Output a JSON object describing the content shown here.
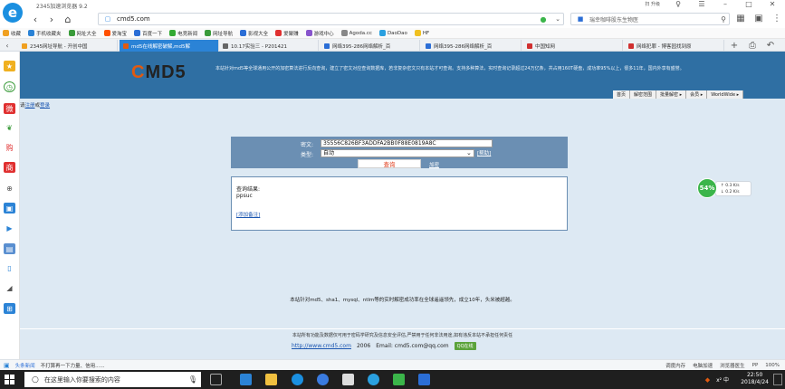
{
  "titlebar": {
    "app_title": "2345加速浏览器 9.2",
    "tray_text": "扫 升级"
  },
  "addressbar": {
    "url": "cmd5.com",
    "search_text": "瑞幸咖啡股东生物医",
    "shield_label": "S"
  },
  "bookmarks": [
    {
      "label": "收藏",
      "color": "#f0a020"
    },
    {
      "label": "手机收藏夹",
      "color": "#2b83d6"
    },
    {
      "label": "网址大全",
      "color": "#3a9b3a"
    },
    {
      "label": "爱淘宝",
      "color": "#ff5000"
    },
    {
      "label": "百度一下",
      "color": "#2b6ed6"
    },
    {
      "label": "电竞新闻",
      "color": "#33aa33"
    },
    {
      "label": "网址导航",
      "color": "#3a9b3a"
    },
    {
      "label": "影视大全",
      "color": "#2b6ed6"
    },
    {
      "label": "爱聚赚",
      "color": "#e03030"
    },
    {
      "label": "游戏中心",
      "color": "#8855cc"
    },
    {
      "label": "Agoda.cc",
      "color": "#888888"
    },
    {
      "label": "DaoDao",
      "color": "#2aa0e0"
    },
    {
      "label": "HF",
      "color": "#f0c020"
    }
  ],
  "tabs": [
    {
      "label": "2345网址导航 - 开创中国",
      "active": false,
      "color": "#f0a020"
    },
    {
      "label": "md5在线解密破解,md5解",
      "active": true,
      "color": "#e05a10"
    },
    {
      "label": "10.17实验三 - P201421",
      "active": false,
      "color": "#666666"
    },
    {
      "label": "网络395-286网络解析_百",
      "active": false,
      "color": "#2b6ed6"
    },
    {
      "label": "网络395-286网络解析_百",
      "active": false,
      "color": "#2b6ed6"
    },
    {
      "label": "中国知网",
      "active": false,
      "color": "#d03030"
    },
    {
      "label": "网络犯罪 - 博客园找到原",
      "active": false,
      "color": "#d03030"
    }
  ],
  "page": {
    "logo_c": "C",
    "logo_rest": "MD5",
    "header_desc": "本站针对md5等全球通用公开的加密算法进行反向查询，建立了密文对应查询数据库，若非复杂密文只有本站才可查询。支持多种算法，实时查询记录超过24万亿条，共占用160T硬盘，成功率95%以上，很多11年，国内外享有盛誉。",
    "top_nav": [
      "首页",
      "解密范围",
      "批量解密 ▸",
      "会员 ▸",
      "WorldWide ▸"
    ],
    "login_prefix": "请",
    "register_link": "注册",
    "or_text": "或",
    "login_link": "登录",
    "ciphertext_label": "密文:",
    "ciphertext_value": "35556C826BF3ADDFA2BB0F88E0819A8C",
    "type_label": "类型:",
    "type_value": "自动",
    "type_help": "[帮助]",
    "query_button": "查询",
    "encrypt_link": "加密",
    "result_title": "查询结果:",
    "result_value": "ppsuc",
    "add_note": "[添加备注]",
    "slogan": "本站针对md5、sha1、mysql、ntlm等的实时解密成功率在全球遥遥领先，成立10年，头米被超越。",
    "footer_disclaimer": "本站所有功能及数据仅可用于密码学研究及信息安全评估,严禁用于任何非法用途,如有违反本站不承担任何责任",
    "footer_url": "http://www.cmd5.com",
    "footer_year": "2006",
    "footer_email": "Email: cmd5.com@qq.com",
    "qq_badge": "QQ在线"
  },
  "speed": {
    "percent": "54%",
    "up": "↑ 0.3 K/s",
    "down": "↓ 0.2 K/s"
  },
  "statusbar": {
    "news_label": "头条新闻",
    "news_text": "不打算再一下力量、信用......",
    "right_items": [
      "调度内存",
      "电脑加速",
      "浏览器医生",
      "PP",
      "100%"
    ]
  },
  "taskbar": {
    "search_placeholder": "在这里输入你要搜索的内容",
    "time": "22:50",
    "date": "2018/4/24",
    "tray_text": "x²  中"
  }
}
